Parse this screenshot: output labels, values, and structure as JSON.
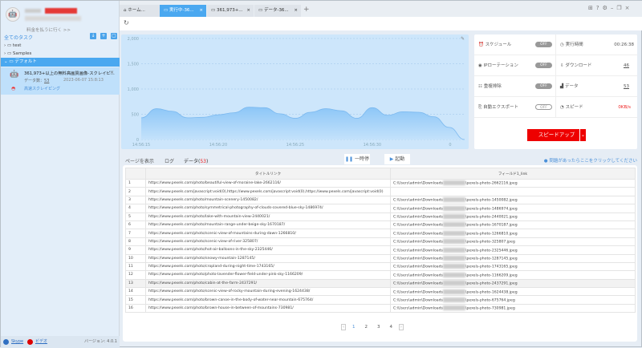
{
  "sidebar": {
    "pay_link": "料金を払うに行く >>",
    "all_tasks": "全てのタスク",
    "folders": [
      {
        "label": "test"
      },
      {
        "label": "Samples"
      },
      {
        "label": "デフォルト"
      }
    ],
    "task": {
      "title": "361,973+以上の無料高画質画像-スクレイピ...",
      "data_label": "データ数：",
      "data_count": "53",
      "timestamp": "2023-06-07 15:8:13",
      "mode": "高速スクレイピング"
    },
    "footer": {
      "skype": "Skype",
      "video": "ビデオ",
      "version": "バージョン: 4.0.1"
    }
  },
  "tabs": [
    {
      "label": "ホーム..."
    },
    {
      "label": "実行中-36..."
    },
    {
      "label": "361,973+..."
    },
    {
      "label": "データ-36..."
    }
  ],
  "chart_data": {
    "type": "area",
    "x": [
      "14:56:15",
      "14:56:16",
      "14:56:17",
      "14:56:18",
      "14:56:19",
      "14:56:20",
      "14:56:21",
      "14:56:22",
      "14:56:23",
      "14:56:24",
      "14:56:25",
      "14:56:26",
      "14:56:27",
      "14:56:28",
      "14:56:29",
      "14:56:30",
      "14:56:31",
      "14:56:32",
      "14:56:33",
      "14:56:34",
      "14:56:35",
      "14:56:36"
    ],
    "values": [
      430,
      610,
      560,
      430,
      440,
      490,
      530,
      640,
      630,
      510,
      420,
      540,
      610,
      570,
      420,
      630,
      480,
      550,
      540,
      450,
      240,
      0
    ],
    "x_ticks": [
      "14:56:15",
      "14:56:20",
      "14:56:25",
      "14:56:30",
      "0"
    ],
    "y_ticks": [
      "0",
      "500",
      "1,000",
      "1,500",
      "2,000"
    ],
    "ylim": [
      0,
      2000
    ],
    "grid": true,
    "color": "#8cc6f7"
  },
  "stats": {
    "schedule": "スケジュール",
    "ip_rotation": "IPローテーション",
    "dedupe": "重複排除",
    "auto_export": "自動エクスポート",
    "off": "OFF",
    "run_time_label": "実行時間",
    "run_time": "00:26:38",
    "download_label": "ダウンロード",
    "download": "46",
    "data_label": "データ",
    "data": "53",
    "speed_label": "スピード",
    "speed": "0KB/s",
    "speed_up": "スピードアップ"
  },
  "subtabs": {
    "view_page": "ページを表示",
    "log": "ログ",
    "data": "データ(",
    "data_count": "53",
    "close": ")",
    "pause": "一時停止",
    "start": "起動",
    "help": "問題があったらここをクリックしてください"
  },
  "table": {
    "headers": [
      "",
      "タイトルリンク",
      "フィールド1_link"
    ],
    "path_prefix": "C:\\Users\\admin\\Downloads",
    "rows": [
      [
        "1",
        "https://www.pexels.com/photo/beautiful-view-of-moraine-lake-2662116/",
        "\\pexels-photo-2662116.jpeg"
      ],
      [
        "2",
        "https://www.pexels.com/javascript:void(0),https://www.pexels.com/javascript:void(0),https://www.pexels.com/javascript:void(0)",
        ""
      ],
      [
        "3",
        "https://www.pexels.com/photo/mountain-scenery-1450082/",
        "\\pexels-photo-1450082.jpeg"
      ],
      [
        "4",
        "https://www.pexels.com/photo/symmetrical-photography-of-clouds-covered-blue-sky-1486974/",
        "\\pexels-photo-1486974.jpeg"
      ],
      [
        "5",
        "https://www.pexels.com/photo/lake-with-mountain-view-2440021/",
        "\\pexels-photo-2440021.jpeg"
      ],
      [
        "6",
        "https://www.pexels.com/photo/mountain-range-under-beige-sky-1670187/",
        "\\pexels-photo-1670187.jpeg"
      ],
      [
        "7",
        "https://www.pexels.com/photo/scenic-view-of-mountains-during-dawn-1266810/",
        "\\pexels-photo-1266810.jpeg"
      ],
      [
        "8",
        "https://www.pexels.com/photo/scenic-view-of-river-325807/",
        "\\pexels-photo-325807.jpeg"
      ],
      [
        "9",
        "https://www.pexels.com/photo/hot-air-balloons-in-the-sky-2325446/",
        "\\pexels-photo-2325446.jpeg"
      ],
      [
        "10",
        "https://www.pexels.com/photo/snowy-mountain-1287145/",
        "\\pexels-photo-1287145.jpeg"
      ],
      [
        "11",
        "https://www.pexels.com/photo/cropland-during-night-time-1743165/",
        "\\pexels-photo-1743165.jpeg"
      ],
      [
        "12",
        "https://www.pexels.com/photo/photo-lavender-flower-field-under-pink-sky-1166209/",
        "\\pexels-photo-1166209.jpeg"
      ],
      [
        "13",
        "https://www.pexels.com/photo/cabin-at-the-farm-2437291/",
        "\\pexels-photo-2437291.jpeg"
      ],
      [
        "14",
        "https://www.pexels.com/photo/scenic-view-of-rocky-mountain-during-evening-1624438/",
        "\\pexels-photo-1624438.jpeg"
      ],
      [
        "15",
        "https://www.pexels.com/photo/brown-canoe-in-the-body-of-water-near-mountain-675764/",
        "\\pexels-photo-675764.jpeg"
      ],
      [
        "16",
        "https://www.pexels.com/photo/brown-house-in-between-of-mountains-730981/",
        "\\pexels-photo-730981.jpeg"
      ]
    ]
  },
  "pagination": {
    "pages": [
      "1",
      "2",
      "3",
      "4"
    ],
    "current": "1"
  }
}
